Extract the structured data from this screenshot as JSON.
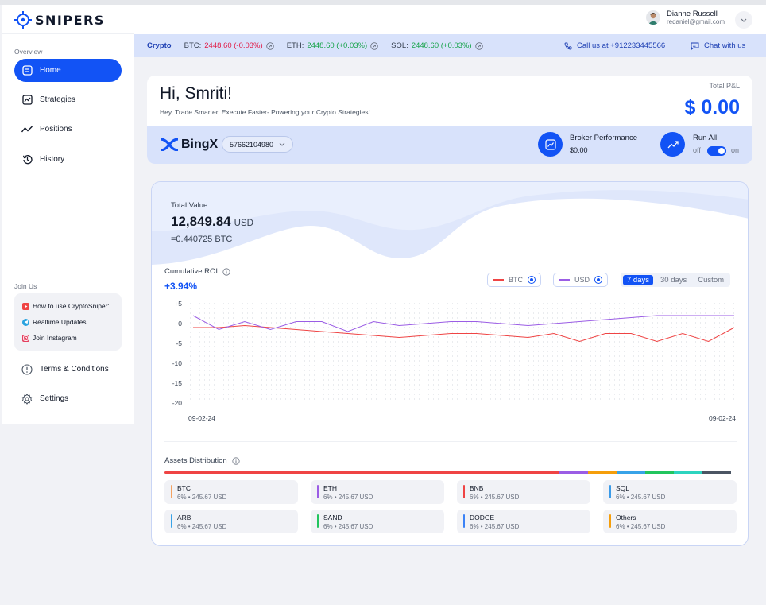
{
  "brand": {
    "name": "SNIPERS"
  },
  "sidebar": {
    "overview_label": "Overview",
    "items": [
      {
        "label": "Home",
        "icon": "home-icon"
      },
      {
        "label": "Strategies",
        "icon": "strategies-icon"
      },
      {
        "label": "Positions",
        "icon": "positions-icon"
      },
      {
        "label": "History",
        "icon": "history-icon"
      }
    ],
    "join_label": "Join Us",
    "join_items": [
      {
        "label": "How to use CryptoSniper'",
        "icon": "youtube-icon"
      },
      {
        "label": "Realtime Updates",
        "icon": "telegram-icon"
      },
      {
        "label": "Join Instagram",
        "icon": "instagram-icon"
      }
    ],
    "bottom_items": [
      {
        "label": "Terms & Conditions",
        "icon": "info-icon"
      },
      {
        "label": "Settings",
        "icon": "gear-icon"
      }
    ]
  },
  "header": {
    "user_name": "Dianne Russell",
    "user_email": "redaniel@gmail.com"
  },
  "ticker": {
    "label": "Crypto",
    "items": [
      {
        "symbol": "BTC:",
        "price": "2448.60 (-0.03%)",
        "trend": "down"
      },
      {
        "symbol": "ETH:",
        "price": "2448.60 (+0.03%)",
        "trend": "up"
      },
      {
        "symbol": "SOL:",
        "price": "2448.60 (+0.03%)",
        "trend": "up"
      }
    ],
    "call_label": "Call us at +912233445566",
    "chat_label": "Chat with us"
  },
  "welcome": {
    "greeting": "Hi, Smriti!",
    "subtitle": "Hey, Trade Smarter, Execute Faster- Powering your Crypto Strategies!",
    "pnl_label": "Total P&L",
    "pnl_value": "$ 0.00"
  },
  "broker": {
    "name": "BingX",
    "account": "57662104980",
    "performance_label": "Broker Performance",
    "performance_value": "$0.00",
    "run_all_label": "Run All",
    "toggle_off": "off",
    "toggle_on": "on",
    "run_all_enabled": true
  },
  "portfolio": {
    "total_value_label": "Total Value",
    "total_value": "12,849.84",
    "total_value_unit": "USD",
    "btc_equivalent": "=0.440725 BTC",
    "roi_label": "Cumulative ROI",
    "roi_value": "+3.94%",
    "legend": [
      {
        "name": "BTC",
        "color": "#ef4444"
      },
      {
        "name": "USD",
        "color": "#9b5de5"
      }
    ],
    "ranges": [
      "7 days",
      "30 days",
      "Custom"
    ],
    "selected_range": "7 days",
    "assets_label": "Assets Distribution"
  },
  "chart_data": {
    "type": "line",
    "x_labels": [
      "09-02-24",
      "09-02-24"
    ],
    "yticks": [
      5,
      0,
      -5,
      -10,
      -15,
      -20
    ],
    "ylim": [
      -20,
      5
    ],
    "grid": true,
    "series": [
      {
        "name": "BTC",
        "color": "#ef4444",
        "values": [
          -1,
          -1,
          -0.5,
          -1,
          -1.5,
          -2,
          -2.5,
          -3,
          -3.5,
          -3,
          -2.5,
          -2.5,
          -3,
          -3.5,
          -2.5,
          -4.5,
          -2.5,
          -2.5,
          -4.5,
          -2.5,
          -4.5,
          -1
        ]
      },
      {
        "name": "USD",
        "color": "#9b5de5",
        "values": [
          2,
          -1.5,
          0.5,
          -1.5,
          0.5,
          0.5,
          -2,
          0.5,
          -0.5,
          0,
          0.5,
          0.5,
          0,
          -0.5,
          0,
          0.5,
          1,
          1.5,
          2,
          2,
          2,
          2
        ]
      }
    ]
  },
  "assets": [
    {
      "name": "BTC",
      "detail": "6% • 245.67 USD",
      "color": "#f4a261"
    },
    {
      "name": "ETH",
      "detail": "6% • 245.67 USD",
      "color": "#9b5de5"
    },
    {
      "name": "BNB",
      "detail": "6% • 245.67 USD",
      "color": "#ef4444"
    },
    {
      "name": "SQL",
      "detail": "6% • 245.67 USD",
      "color": "#3b9be8"
    },
    {
      "name": "ARB",
      "detail": "6% • 245.67 USD",
      "color": "#38a3e8"
    },
    {
      "name": "SAND",
      "detail": "6% • 245.67 USD",
      "color": "#22c55e"
    },
    {
      "name": "DODGE",
      "detail": "6% • 245.67 USD",
      "color": "#3b82f6"
    },
    {
      "name": "Others",
      "detail": "6% • 245.67 USD",
      "color": "#f59e0b"
    }
  ],
  "distribution": [
    {
      "color": "#ef4444",
      "share": 0.69
    },
    {
      "color": "#9b5de5",
      "share": 0.05
    },
    {
      "color": "#f59e0b",
      "share": 0.05
    },
    {
      "color": "#38a3e8",
      "share": 0.05
    },
    {
      "color": "#22c55e",
      "share": 0.05
    },
    {
      "color": "#2dd4bf",
      "share": 0.05
    },
    {
      "color": "#4b5563",
      "share": 0.05
    }
  ]
}
